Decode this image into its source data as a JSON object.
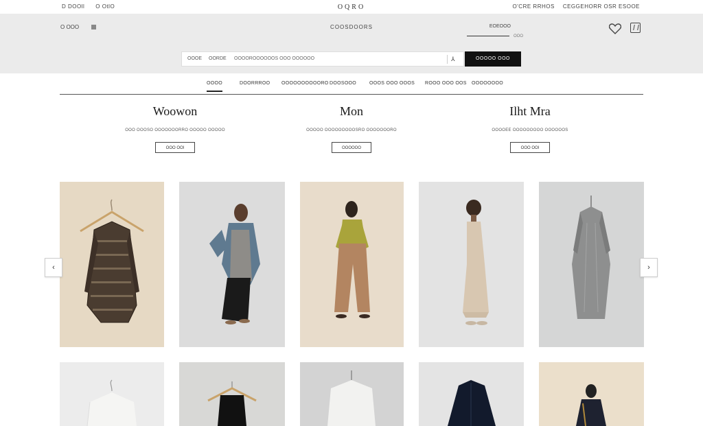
{
  "topbar": {
    "left_items": [
      "D DOOll",
      "O OtlO"
    ],
    "brand": "OQRO",
    "right_items": [
      "O'CRE RRHOS",
      "CEGGEHORR OSR ESOOE"
    ]
  },
  "header": {
    "menu_label": "O OOO",
    "logo_sub": "COOSDOORS",
    "account_label": "EOEOOO",
    "account_sub": "OOO"
  },
  "search": {
    "scope": [
      "OOOE",
      "OORDE"
    ],
    "placeholder": "OOOOROOOOOOS OOO OOOOOO",
    "button_label": "OOOOO OOO"
  },
  "tabs": [
    {
      "label": "OOOO",
      "active": true
    },
    {
      "label": "DOORRROO",
      "active": false
    },
    {
      "label": "OOOOOOOOOORO",
      "active": false
    },
    {
      "label": "DOOSOOO",
      "active": false
    },
    {
      "label": "OOOS OOO OOOS",
      "active": false
    },
    {
      "label": "ROOO OOO OOS",
      "active": false
    },
    {
      "label": "OOOOOOOO",
      "active": false
    }
  ],
  "categories": [
    {
      "title": "Woowon",
      "subtitle": "OOO OOOSO OOOOOOORRO OOOOO OOOOO",
      "button": "OOO OOI"
    },
    {
      "title": "Mon",
      "subtitle": "OOOOO OOOOOOOOOSRO OOOOOOORO",
      "button": "OOOOOO"
    },
    {
      "title": "Ilht Mra",
      "subtitle": "OOOOEE OOOOOOOOO OOOOOOS",
      "button": "OOO OOI"
    }
  ],
  "carousel": {
    "prev_icon": "‹",
    "next_icon": "›"
  },
  "colors": {
    "band": "#ebebeb",
    "button_dark": "#111111",
    "tile_beige": "#e6d9c4",
    "tile_grey": "#d9dbdc"
  }
}
